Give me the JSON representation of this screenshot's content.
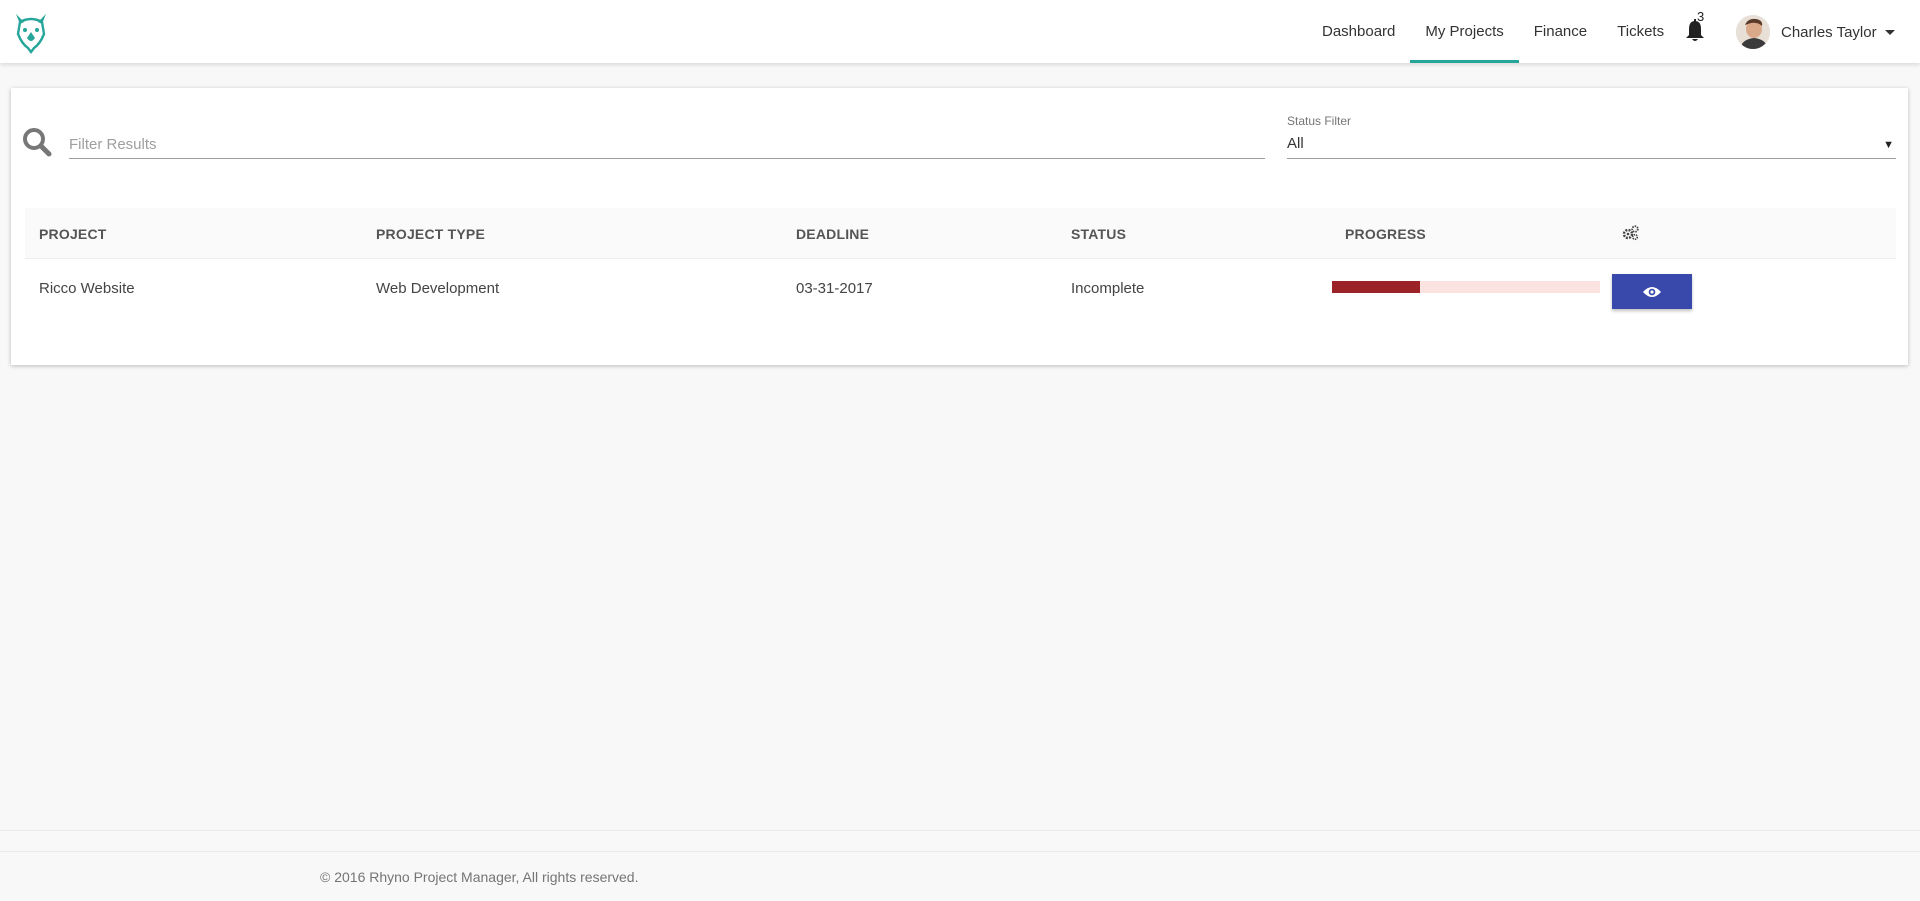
{
  "app": {
    "logo_icon": "rhino-logo-icon",
    "accent_color": "#26a69a"
  },
  "nav": {
    "items": [
      {
        "label": "Dashboard",
        "active": false
      },
      {
        "label": "My Projects",
        "active": true
      },
      {
        "label": "Finance",
        "active": false
      },
      {
        "label": "Tickets",
        "active": false
      }
    ],
    "notifications": {
      "icon": "bell-icon",
      "count": "3"
    },
    "user": {
      "name": "Charles Taylor",
      "icon": "chevron-down-icon"
    }
  },
  "filter": {
    "search_icon": "search-icon",
    "placeholder": "Filter Results",
    "value": "",
    "status_label": "Status Filter",
    "status_value": "All"
  },
  "table": {
    "headers": [
      "PROJECT",
      "PROJECT TYPE",
      "DEADLINE",
      "STATUS",
      "PROGRESS"
    ],
    "actions_icon": "gears-icon",
    "rows": [
      {
        "project": "Ricco Website",
        "type": "Web Development",
        "deadline": "03-31-2017",
        "status": "Incomplete",
        "progress": 0.33,
        "progress_color": "#9b2226",
        "progress_track_color": "#fbe3e1",
        "action_icon": "eye-icon",
        "action_color": "#3949ab"
      }
    ]
  },
  "footer": {
    "text": "© 2016 Rhyno Project Manager, All rights reserved."
  }
}
